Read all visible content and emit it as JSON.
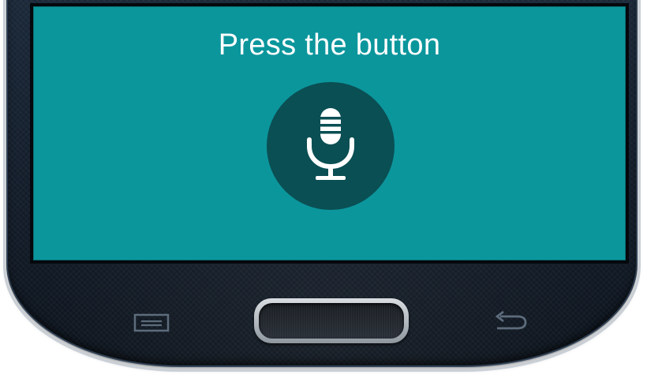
{
  "screen": {
    "prompt_text": "Press the button",
    "background_color": "#0b969c",
    "button_color": "#0a4f53"
  },
  "icons": {
    "mic": "microphone-icon",
    "menu": "menu-key-icon",
    "back": "back-arrow-icon"
  }
}
